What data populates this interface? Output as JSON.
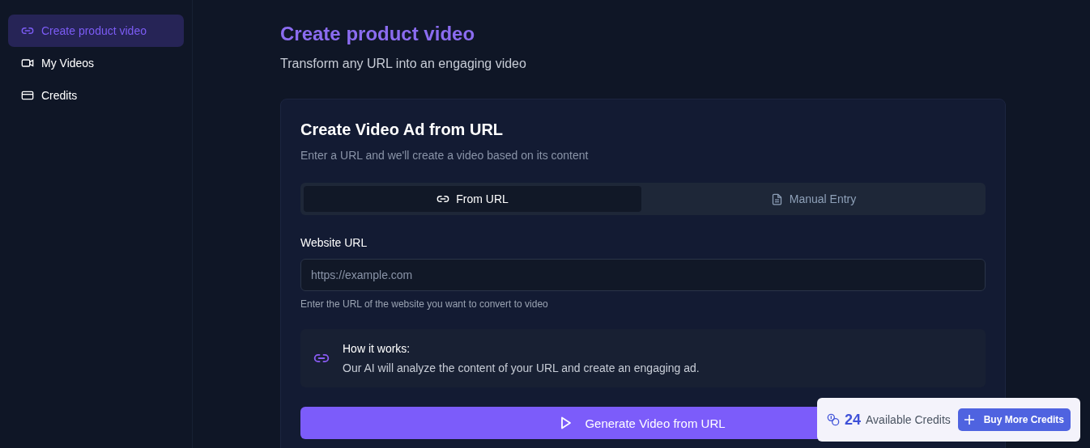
{
  "sidebar": {
    "items": [
      {
        "label": "Create product video",
        "selected": true
      },
      {
        "label": "My Videos",
        "selected": false
      },
      {
        "label": "Credits",
        "selected": false
      }
    ]
  },
  "page": {
    "title": "Create product video",
    "subtitle": "Transform any URL into an engaging video"
  },
  "card": {
    "title": "Create Video Ad from URL",
    "subtitle": "Enter a URL and we'll create a video based on its content",
    "tabs": [
      {
        "label": "From URL",
        "selected": true
      },
      {
        "label": "Manual Entry",
        "selected": false
      }
    ],
    "field": {
      "label": "Website URL",
      "placeholder": "https://example.com",
      "help": "Enter the URL of the website you want to convert to video"
    },
    "info": {
      "title": "How it works:",
      "text": "Our AI will analyze the content of your URL and create an engaging ad."
    },
    "submit": "Generate Video from URL"
  },
  "credits": {
    "count": "24",
    "label": "Available Credits",
    "button": "Buy More Credits"
  }
}
